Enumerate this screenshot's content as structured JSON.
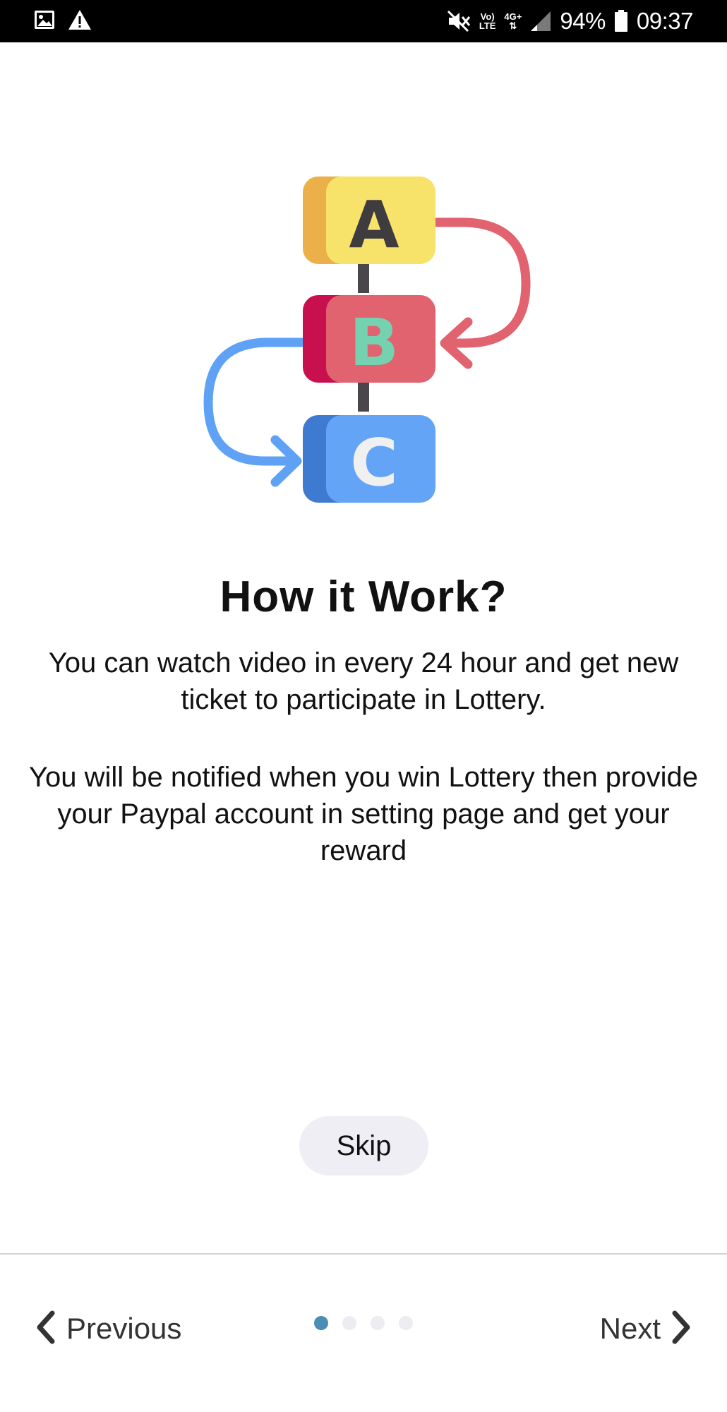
{
  "status_bar": {
    "left_icons": [
      "image-icon",
      "warning-icon"
    ],
    "right_icons": [
      "mute-icon",
      "volte-icon",
      "network-4g-icon",
      "signal-icon",
      "battery-icon"
    ],
    "volte_top": "Vo)",
    "volte_bottom": "LTE",
    "network_label": "4G+",
    "battery_percent": "94%",
    "time": "09:37"
  },
  "illustration": {
    "letters": [
      "A",
      "B",
      "C"
    ],
    "colors": {
      "a_front": "#F7E36A",
      "a_back": "#ECB04A",
      "b_front": "#E0636F",
      "b_back": "#C8104F",
      "c_front": "#63A4F7",
      "c_back": "#3E7BD0",
      "connector": "#4a464c",
      "right_arrow": "#E0636F",
      "left_arrow": "#5FA2F5",
      "b_letter": "#74D2B0",
      "c_letter": "#F0F0F0",
      "a_letter": "#3f3c40"
    }
  },
  "content": {
    "heading": "How it Work?",
    "paragraph_1": "You can watch video in every 24 hour and get new ticket to participate in Lottery.",
    "paragraph_2": "You will be notified when you win Lottery then provide your Paypal account in setting page and get your reward"
  },
  "skip_button": {
    "label": "Skip"
  },
  "bottom_nav": {
    "previous_label": "Previous",
    "next_label": "Next",
    "page_count": 4,
    "active_index": 0,
    "active_color": "#4a8db5"
  }
}
